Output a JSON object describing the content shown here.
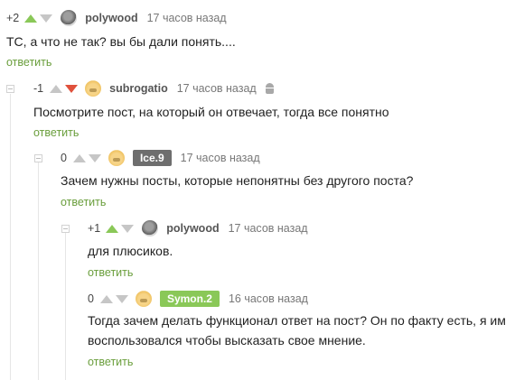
{
  "reply_label": "ответить",
  "colors": {
    "upvote_active": "#8ac858",
    "downvote_active": "#e0513c",
    "arrow_inactive": "#c6c6c6",
    "reply_link": "#6a9e3c",
    "badge_ice9": "#6e6e6e",
    "badge_symon2": "#8ac858"
  },
  "comments": [
    {
      "rating": "+2",
      "vote": "up",
      "avatar": "grey-avatar",
      "author": "polywood",
      "time": "17 часов назад",
      "text": [
        "ТС, а что не так? вы бы дали понять...."
      ]
    },
    {
      "rating": "-1",
      "vote": "down",
      "avatar": "yellow-avatar",
      "author": "subrogatio",
      "time": "17 часов назад",
      "device_icon": "android-icon",
      "text": [
        "Посмотрите пост, на который он отвечает, тогда все понятно"
      ]
    },
    {
      "rating": "0",
      "vote": "none",
      "avatar": "yellow-avatar",
      "author": "Ice.9",
      "author_badge": true,
      "time": "17 часов назад",
      "text": [
        "Зачем нужны посты, которые непонятны без другого поста?"
      ]
    },
    {
      "rating": "+1",
      "vote": "up",
      "avatar": "grey-avatar",
      "author": "polywood",
      "time": "17 часов назад",
      "text": [
        "для плюсиков."
      ]
    },
    {
      "rating": "0",
      "vote": "none",
      "avatar": "yellow-avatar",
      "author": "Symon.2",
      "author_badge": true,
      "time": "16 часов назад",
      "text": [
        "Тогда зачем делать функционал ответ на пост? Он по факту есть, я им",
        "воспользовался чтобы высказать свое мнение."
      ]
    }
  ]
}
